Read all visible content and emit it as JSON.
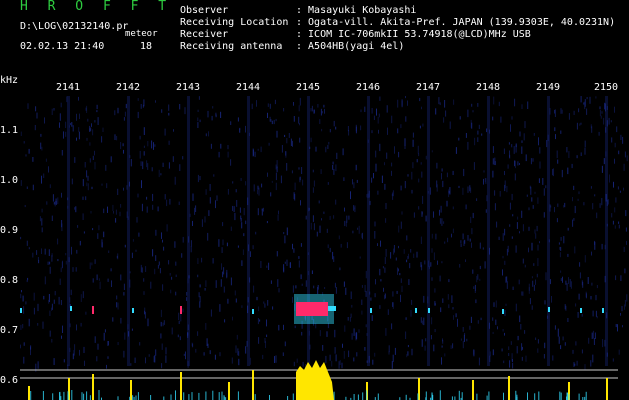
{
  "header": {
    "app_title": "H R O F F T",
    "file_path": "D:\\LOG\\02132140.pr",
    "mode_label": "meteor",
    "timestamp": "02.02.13 21:40",
    "count": "18"
  },
  "info": [
    {
      "label": "Observer",
      "value": ": Masayuki Kobayashi"
    },
    {
      "label": "Receiving Location",
      "value": ": Ogata-vill. Akita-Pref. JAPAN (139.9303E, 40.0231N)"
    },
    {
      "label": "Receiver",
      "value": ": ICOM IC-706mkII 53.74918(@LCD)MHz USB"
    },
    {
      "label": "Receiving antenna",
      "value": ": A504HB(yagi 4el)"
    }
  ],
  "spectrogram": {
    "y_unit": "kHz",
    "x_ticks": [
      "2141",
      "2142",
      "2143",
      "2144",
      "2145",
      "2146",
      "2147",
      "2148",
      "2149",
      "2150"
    ],
    "y_ticks": [
      "1.1",
      "1.0",
      "0.9",
      "0.8",
      "0.7",
      "0.6"
    ],
    "colors": {
      "background": "#000000",
      "noise": "#1a2a8a",
      "echo": "#ff2a6a",
      "echo_glow": "#33ddff",
      "level_bars": "#ffe600",
      "baseline": "#cccccc"
    },
    "echo_minute": "2145"
  }
}
